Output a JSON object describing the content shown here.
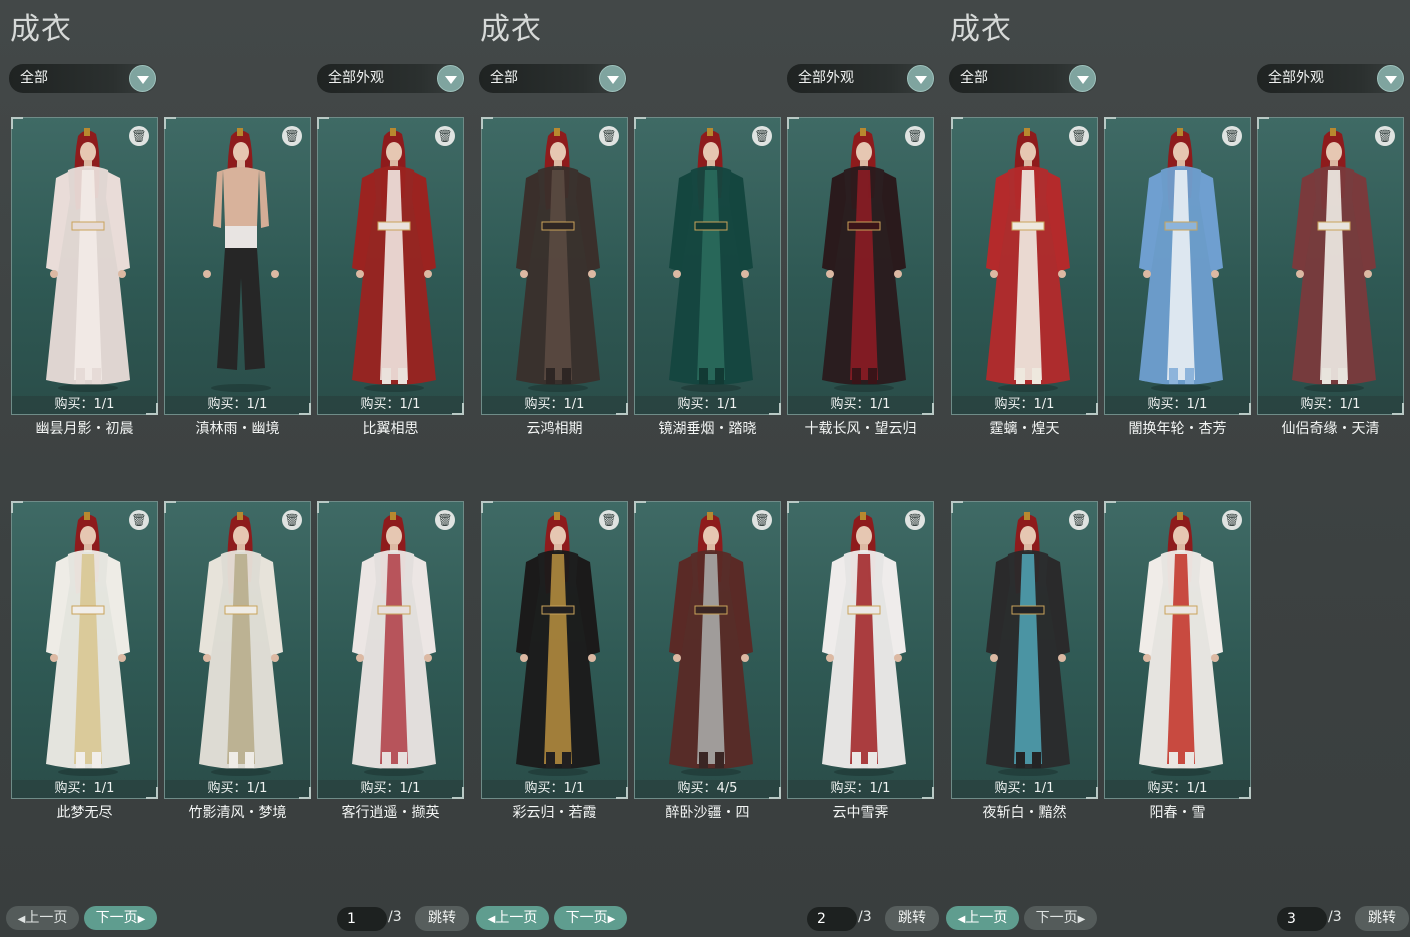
{
  "panels": [
    {
      "title": "成衣",
      "filter_label": "全部",
      "appearance_label": "全部外观",
      "page": "1",
      "page_total": "/3",
      "prev_label": "上一页",
      "next_label": "下一页",
      "jump_label": "跳转",
      "items": [
        {
          "name": "幽昙月影・初晨",
          "purchase": "购买：1/1",
          "robe": "#e9dcd8",
          "accent": "#f3ebe7",
          "pants": "#e6dbd7"
        },
        {
          "name": "滇林雨・幽境",
          "purchase": "购买：1/1",
          "robe": "none",
          "accent": "#e8e4e2",
          "pants": "#262626"
        },
        {
          "name": "比翼相思",
          "purchase": "购买：1/1",
          "robe": "#9b2320",
          "accent": "#efe6e0",
          "pants": "#eae2dc"
        },
        {
          "name": "此梦无尽",
          "purchase": "购买：1/1",
          "robe": "#eeece6",
          "accent": "#d8c792",
          "pants": "#f1eeea"
        },
        {
          "name": "竹影清风・梦境",
          "purchase": "购买：1/1",
          "robe": "#e7e3da",
          "accent": "#b8ad8c",
          "pants": "#efece6"
        },
        {
          "name": "客行逍遥・撷英",
          "purchase": "购买：1/1",
          "robe": "#ece6e4",
          "accent": "#b3454c",
          "pants": "#e8e0de"
        }
      ]
    },
    {
      "title": "成衣",
      "filter_label": "全部",
      "appearance_label": "全部外观",
      "page": "2",
      "page_total": "/3",
      "prev_label": "上一页",
      "next_label": "下一页",
      "jump_label": "跳转",
      "items": [
        {
          "name": "云鸿相期",
          "purchase": "购买：1/1",
          "robe": "#3a2f2b",
          "accent": "#5b4a41",
          "pants": "#2e2624"
        },
        {
          "name": "镜湖垂烟・踏晓",
          "purchase": "购买：1/1",
          "robe": "#14463f",
          "accent": "#2a6a5c",
          "pants": "#123a34"
        },
        {
          "name": "十载长风・望云归",
          "purchase": "购买：1/1",
          "robe": "#2a1a1c",
          "accent": "#8b1c24",
          "pants": "#3a1418"
        },
        {
          "name": "彩云归・若霞",
          "purchase": "购买：1/1",
          "robe": "#1b1a1a",
          "accent": "#b08a3e",
          "pants": "#222020"
        },
        {
          "name": "醉卧沙疆・四",
          "purchase": "购买：4/5",
          "robe": "#5a2a26",
          "accent": "#a9a9a6",
          "pants": "#3a2624"
        },
        {
          "name": "云中雪霁",
          "purchase": "购买：1/1",
          "robe": "#efeceb",
          "accent": "#a32a2c",
          "pants": "#ebe8e6"
        }
      ]
    },
    {
      "title": "成衣",
      "filter_label": "全部",
      "appearance_label": "全部外观",
      "page": "3",
      "page_total": "/3",
      "prev_label": "上一页",
      "next_label": "下一页",
      "jump_label": "跳转",
      "items": [
        {
          "name": "霆螭・煌天",
          "purchase": "购买：1/1",
          "robe": "#b42a2b",
          "accent": "#f1ece3",
          "pants": "#eee8de"
        },
        {
          "name": "闇换年轮・杏芳",
          "purchase": "购买：1/1",
          "robe": "#6f9fd0",
          "accent": "#eaf0f4",
          "pants": "#8db4db"
        },
        {
          "name": "仙侣奇缘・天清",
          "purchase": "购买：1/1",
          "robe": "#7a3a3c",
          "accent": "#efece6",
          "pants": "#e8e4dd"
        },
        {
          "name": "夜斩白・黯然",
          "purchase": "购买：1/1",
          "robe": "#2a2a2b",
          "accent": "#4fa0b0",
          "pants": "#242425"
        },
        {
          "name": "阳春・雪",
          "purchase": "购买：1/1",
          "robe": "#f0ece8",
          "accent": "#c4382f",
          "pants": "#ebe6e2"
        }
      ]
    }
  ]
}
